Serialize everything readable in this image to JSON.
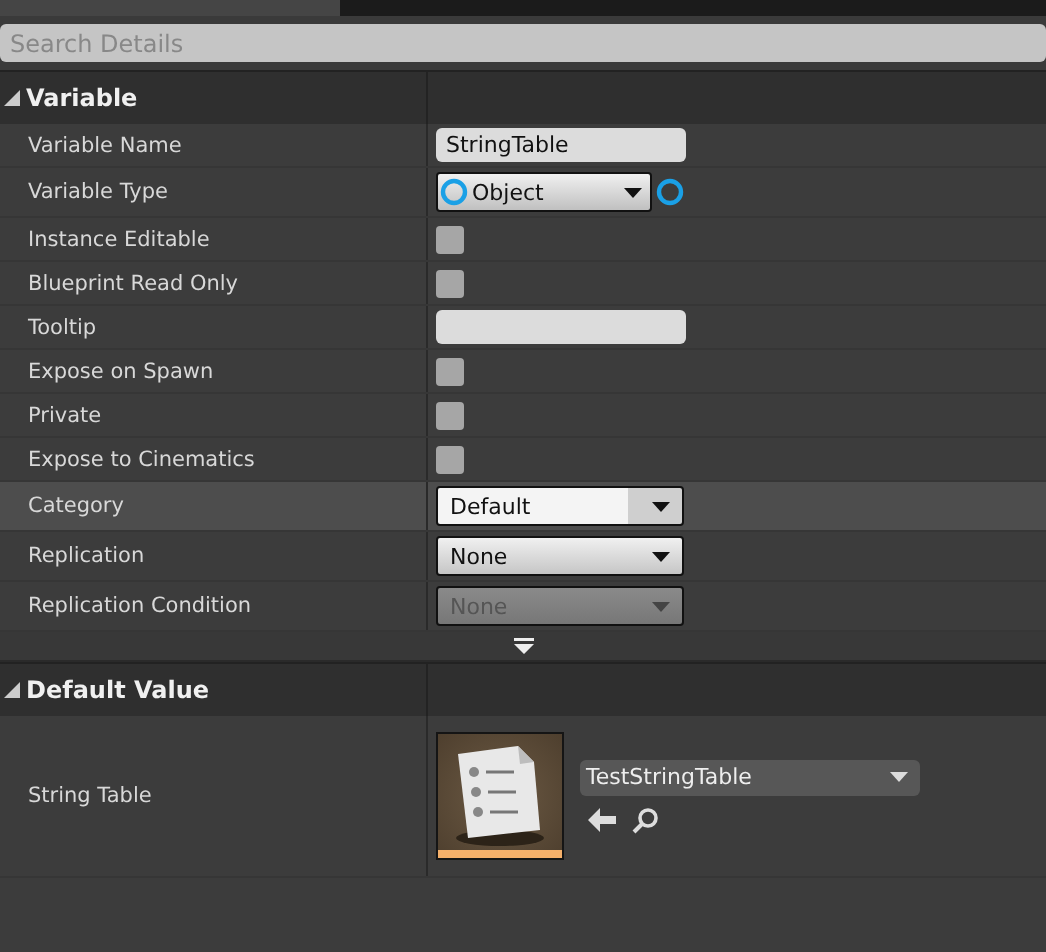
{
  "search": {
    "placeholder": "Search Details"
  },
  "sections": [
    {
      "title": "Variable",
      "expanded": true,
      "rows": [
        {
          "label": "Variable Name",
          "kind": "text",
          "value": "StringTable",
          "highlighted": false
        },
        {
          "label": "Variable Type",
          "kind": "type",
          "value": "Object",
          "highlighted": false
        },
        {
          "label": "Instance Editable",
          "kind": "checkbox",
          "checked": false,
          "highlighted": false
        },
        {
          "label": "Blueprint Read Only",
          "kind": "checkbox",
          "checked": false,
          "highlighted": false
        },
        {
          "label": "Tooltip",
          "kind": "text",
          "value": "",
          "highlighted": false
        },
        {
          "label": "Expose on Spawn",
          "kind": "checkbox",
          "checked": false,
          "highlighted": false
        },
        {
          "label": "Private",
          "kind": "checkbox",
          "checked": false,
          "highlighted": false
        },
        {
          "label": "Expose to Cinematics",
          "kind": "checkbox",
          "checked": false,
          "highlighted": false
        },
        {
          "label": "Category",
          "kind": "combo",
          "value": "Default",
          "highlighted": true
        },
        {
          "label": "Replication",
          "kind": "dropdown",
          "value": "None",
          "disabled": false,
          "highlighted": false
        },
        {
          "label": "Replication Condition",
          "kind": "dropdown",
          "value": "None",
          "disabled": true,
          "highlighted": false
        }
      ],
      "advanced": true
    },
    {
      "title": "Default Value",
      "expanded": true,
      "rows": [
        {
          "label": "String Table",
          "kind": "asset",
          "value": "TestStringTable",
          "highlighted": false
        }
      ]
    }
  ]
}
